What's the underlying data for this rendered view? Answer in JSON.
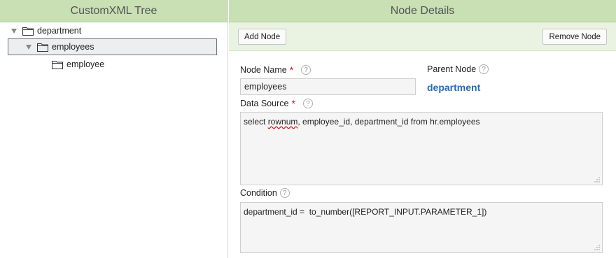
{
  "tree_panel": {
    "title": "CustomXML Tree",
    "nodes": [
      {
        "label": "department"
      },
      {
        "label": "employees"
      },
      {
        "label": "employee"
      }
    ]
  },
  "details_panel": {
    "title": "Node Details",
    "toolbar": {
      "add_label": "Add Node",
      "remove_label": "Remove Node"
    },
    "node_name": {
      "label": "Node Name",
      "required_mark": "*",
      "value": "employees"
    },
    "parent_node": {
      "label": "Parent Node",
      "value": "department"
    },
    "data_source": {
      "label": "Data Source",
      "required_mark": "*",
      "value_before": "select ",
      "value_misspelled": "rownum",
      "value_after": ", employee_id, department_id from hr.employees"
    },
    "condition": {
      "label": "Condition",
      "value": "department_id =  to_number([REPORT_INPUT.PARAMETER_1])"
    },
    "help_glyph": "?"
  },
  "colors": {
    "header_bg": "#c8e0b4",
    "toolbar_bg": "#eaf3e2",
    "required": "#cc1a1a",
    "link_blue": "#2a6bb7"
  },
  "icons": [
    "expand-arrow-icon",
    "folder-icon",
    "help-icon",
    "resize-grip-icon"
  ]
}
